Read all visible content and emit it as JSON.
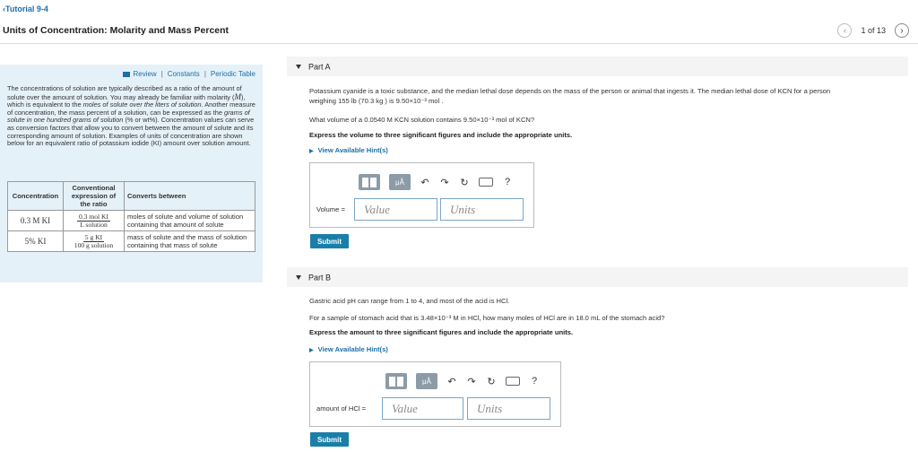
{
  "nav": {
    "back_link": "‹Tutorial 9-4"
  },
  "title": "Units of Concentration: Molarity and Mass Percent",
  "pager": {
    "text": "1 of 13",
    "prev": "‹",
    "next": "›"
  },
  "resources": {
    "review": "Review",
    "constants": "Constants",
    "periodic": "Periodic Table",
    "sep": "|"
  },
  "intro": {
    "p1": "The concentrations of solution are typically described as a ratio of the amount of solute over the amount of solution. You may already be familiar with molarity (",
    "M": "M",
    "p2": "), which is equivalent to the ",
    "i1": "moles of solute over the liters of solution",
    "p3": ". Another measure of concentration, the mass percent of a solution, can be expressed as the ",
    "i2": "grams of solute in one hundred grams of solution",
    "p4": " (% or wt%). Concentration values can serve as conversion factors that allow you to convert between the amount of solute and its corresponding amount of solution. Examples of units of concentration are shown below for an equivalent ratio of potassium iodide (KI) amount over solution amount."
  },
  "table": {
    "headers": [
      "Concentration",
      "Conventional expression of the ratio",
      "Converts between"
    ],
    "rows": [
      {
        "conc": "0.3 M  KI",
        "num": "0.3 mol KI",
        "den": "L solution",
        "converts": "moles of solute and volume of solution containing that amount of solute"
      },
      {
        "conc": "5%  KI",
        "num": "5 g KI",
        "den": "100 g solution",
        "converts": "mass of solute and the mass of solution containing that mass of solute"
      }
    ]
  },
  "partA": {
    "label": "Part A",
    "line1": "Potassium cyanide is a toxic substance, and the median lethal dose depends on the mass of the person or animal that ingests it. The median lethal dose of KCN for a person",
    "line2": "weighing 155 lb (70.3 kg ) is 9.50×10⁻³ mol .",
    "question": "What volume of a 0.0540 M  KCN solution contains 9.50×10⁻³ mol of KCN?",
    "instruction": "Express the volume to three significant figures and include the appropriate units.",
    "hints": "View Available Hint(s)",
    "field_label": "Volume =",
    "value_placeholder": "Value",
    "units_placeholder": "Units",
    "submit": "Submit"
  },
  "partB": {
    "label": "Part B",
    "line1": "Gastric acid pH can range from 1 to 4, and most of the acid is HCl.",
    "question": "For a sample of stomach acid that is 3.48×10⁻³ M in HCl, how many moles of HCl are in 18.0 mL of the stomach acid?",
    "instruction": "Express the amount to three significant figures and include the appropriate units.",
    "hints": "View Available Hint(s)",
    "field_label": "amount of HCl =",
    "value_placeholder": "Value",
    "units_placeholder": "Units",
    "submit": "Submit"
  },
  "toolbar": {
    "mu": "μÅ",
    "undo": "↶",
    "redo": "↷",
    "reset": "↻",
    "help": "?"
  },
  "colors": {
    "accent": "#1a7fa8",
    "link": "#1a6fa8",
    "panel": "#e5f1f8"
  }
}
